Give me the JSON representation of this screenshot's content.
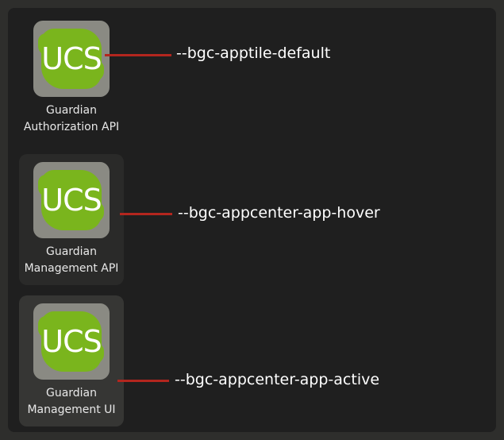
{
  "tiles": [
    {
      "state": "default",
      "icon_text": "UCS",
      "label": "Guardian\nAuthorization API"
    },
    {
      "state": "hover",
      "icon_text": "UCS",
      "label": "Guardian\nManagement API"
    },
    {
      "state": "active",
      "icon_text": "UCS",
      "label": "Guardian\nManagement UI"
    }
  ],
  "callouts": [
    "--bgc-apptile-default",
    "--bgc-appcenter-app-hover",
    "--bgc-appcenter-app-active"
  ],
  "colors": {
    "page_background": "#2e2e2c",
    "panel_background": "#1f1f1f",
    "tile_default": "transparent",
    "tile_hover": "#2a2a29",
    "tile_active": "#363634",
    "icon_frame": "#8a8a83",
    "icon_blob": "#7ab51d",
    "connector": "#b3261e",
    "label_text": "#e8e8e8",
    "callout_text": "#ffffff"
  }
}
